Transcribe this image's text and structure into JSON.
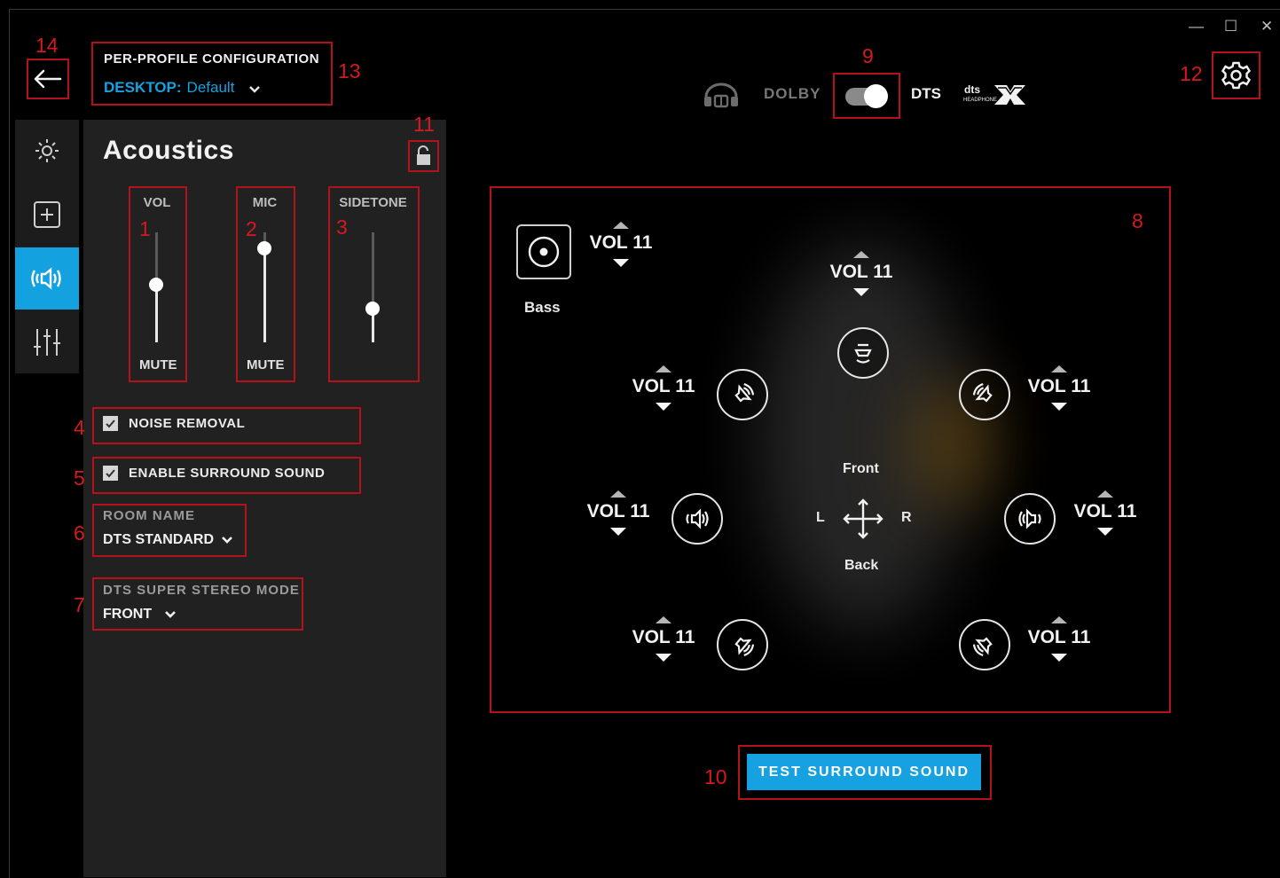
{
  "window": {
    "minimize_glyph": "—",
    "maximize_glyph": "☐",
    "close_glyph": "✕"
  },
  "header": {
    "config_title": "PER-PROFILE CONFIGURATION",
    "profile_prefix": "DESKTOP:",
    "profile_name": "Default",
    "dolby_label": "DOLBY",
    "dts_label": "DTS",
    "dts_toggle_on": true
  },
  "sidebar": {
    "items": [
      {
        "icon": "brightness-icon",
        "active": false
      },
      {
        "icon": "add-icon",
        "active": false
      },
      {
        "icon": "speaker-icon",
        "active": true
      },
      {
        "icon": "equalizer-icon",
        "active": false
      }
    ]
  },
  "panel": {
    "title": "Acoustics",
    "sliders": [
      {
        "label": "VOL",
        "bottom": "MUTE",
        "level": 0.5
      },
      {
        "label": "MIC",
        "bottom": "MUTE",
        "level": 0.85
      },
      {
        "label": "SIDETONE",
        "bottom": "",
        "level": 0.3
      }
    ],
    "noise_removal": {
      "label": "NOISE REMOVAL",
      "checked": true
    },
    "surround": {
      "label": "ENABLE SURROUND SOUND",
      "checked": true
    },
    "room": {
      "label": "ROOM NAME",
      "value": "DTS STANDARD"
    },
    "stereo_mode": {
      "label": "DTS SUPER STEREO MODE",
      "value": "FRONT"
    }
  },
  "surround_panel": {
    "bass_label": "Bass",
    "vol_text": "VOL 11",
    "front_label": "Front",
    "back_label": "Back",
    "left_label": "L",
    "right_label": "R"
  },
  "test_button": "TEST SURROUND SOUND",
  "annotations": [
    "1",
    "2",
    "3",
    "4",
    "5",
    "6",
    "7",
    "8",
    "9",
    "10",
    "11",
    "12",
    "13",
    "14"
  ],
  "colors": {
    "accent": "#16a2e0",
    "annotation": "#d51a1f",
    "panel_bg": "#212121"
  }
}
